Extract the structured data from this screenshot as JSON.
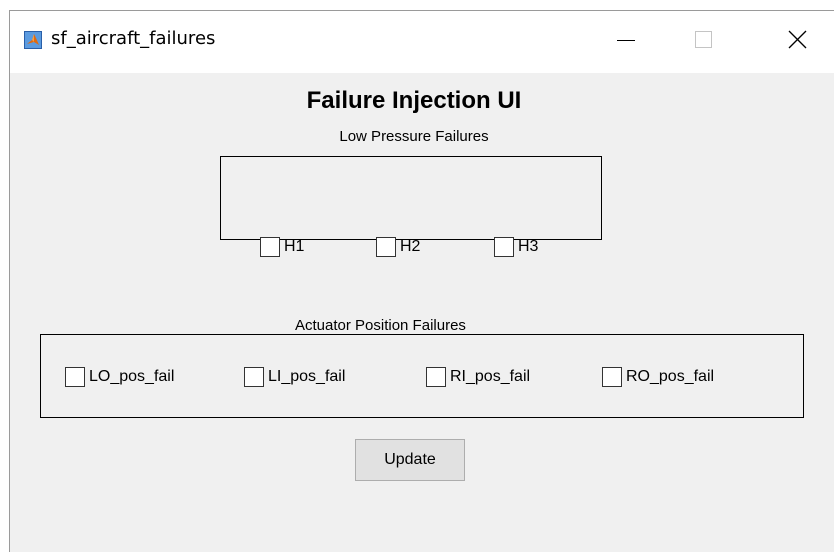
{
  "window": {
    "title": "sf_aircraft_failures",
    "controls": {
      "minimize": "minimize",
      "maximize": "maximize",
      "close": "close"
    }
  },
  "form": {
    "heading": "Failure Injection UI",
    "low_pressure": {
      "title": "Low Pressure Failures",
      "items": [
        {
          "label": "H1",
          "checked": false
        },
        {
          "label": "H2",
          "checked": false
        },
        {
          "label": "H3",
          "checked": false
        }
      ]
    },
    "actuator": {
      "title": "Actuator Position Failures",
      "items": [
        {
          "label": "LO_pos_fail",
          "checked": false
        },
        {
          "label": "LI_pos_fail",
          "checked": false
        },
        {
          "label": "RI_pos_fail",
          "checked": false
        },
        {
          "label": "RO_pos_fail",
          "checked": false
        }
      ]
    },
    "update_label": "Update"
  },
  "icons": {
    "app": "matlab-icon",
    "minimize": "minimize-icon",
    "maximize": "maximize-icon",
    "close": "close-icon"
  },
  "colors": {
    "window_bg": "#f0f0f0",
    "titlebar_bg": "#ffffff",
    "button_bg": "#e1e1e1"
  }
}
